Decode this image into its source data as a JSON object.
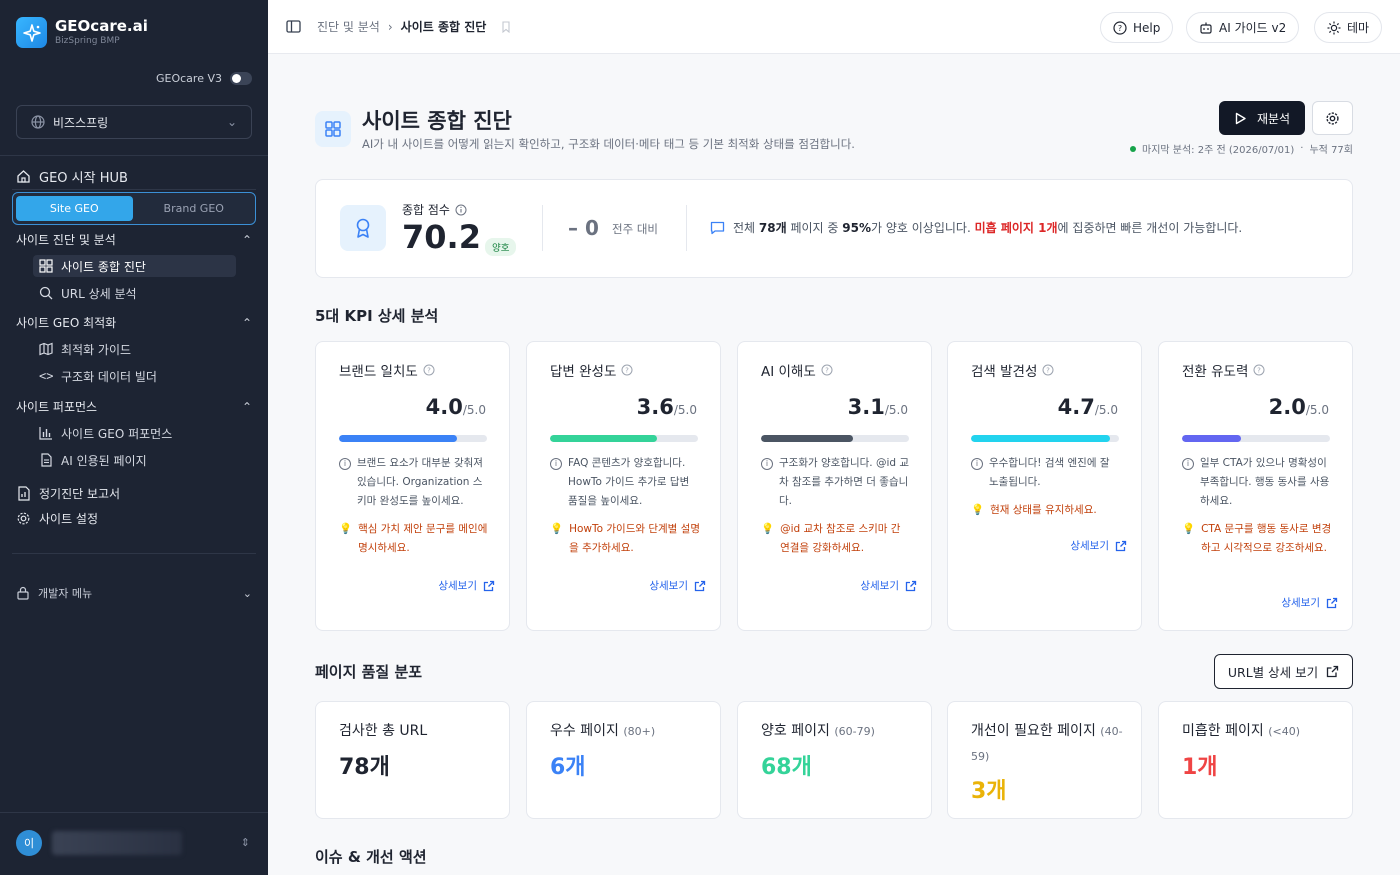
{
  "colors": {
    "sidebar_bg": "#1d2433",
    "accent": "#2563eb",
    "good": "#15803d",
    "warn": "#c2410c",
    "bad": "#dc2626"
  },
  "app": {
    "name": "GEOcare.ai",
    "subtitle": "BizSpring BMP",
    "version_label": "GEOcare V3"
  },
  "sidebar": {
    "org": "비즈스프링",
    "hub": "GEO 시작 HUB",
    "segment": {
      "site": "Site GEO",
      "brand": "Brand GEO"
    },
    "groups": [
      {
        "title": "사이트 진단 및 분석",
        "items": [
          "사이트 종합 진단",
          "URL 상세 분석"
        ]
      },
      {
        "title": "사이트 GEO 최적화",
        "items": [
          "최적화 가이드",
          "구조화 데이터 빌더"
        ]
      },
      {
        "title": "사이트 퍼포먼스",
        "items": [
          "사이트 GEO 퍼포먼스",
          "AI 인용된 페이지"
        ]
      }
    ],
    "report": "정기진단 보고서",
    "settings": "사이트 설정",
    "dev_menu": "개발자 메뉴",
    "user_initial": "이"
  },
  "topbar": {
    "breadcrumb": [
      "진단 및 분석",
      "사이트 종합 진단"
    ],
    "help": "Help",
    "ai_guide": "AI 가이드 v2",
    "theme": "테마"
  },
  "header": {
    "title": "사이트 종합 진단",
    "desc": "AI가 내 사이트를 어떻게 읽는지 확인하고, 구조화 데이터·메타 태그 등 기본 최적화 상태를 점검합니다.",
    "reanalyze": "재분석",
    "last_analysis": "마지막 분석: 2주 전 (2026/07/01)",
    "sep": "·",
    "cumulative": "누적 77회"
  },
  "score": {
    "label": "종합 점수",
    "value": "70.2",
    "badge": "양호",
    "delta": "– 0",
    "delta_label": "전주 대비",
    "summary": {
      "p1": "전체 ",
      "total": "78개",
      "p2": " 페이지 중 ",
      "pct": "95%",
      "p3": "가 양호 이상입니다. ",
      "poor": "미흡 페이지 1개",
      "p4": "에 집중하면 빠른 개선이 가능합니다."
    }
  },
  "kpi_section_title": "5대 KPI 상세 분석",
  "kpis": [
    {
      "name": "브랜드 일치도",
      "score": "4.0",
      "max": "/5.0",
      "ratio": 0.8,
      "color": "#3b82f6",
      "note": "브랜드 요소가 대부분 갖춰져 있습니다. Organization 스키마 완성도를 높이세요.",
      "tip": "핵심 가치 제안 문구를 메인에 명시하세요.",
      "more": "상세보기"
    },
    {
      "name": "답변 완성도",
      "score": "3.6",
      "max": "/5.0",
      "ratio": 0.72,
      "color": "#34d399",
      "note": "FAQ 콘텐츠가 양호합니다. HowTo 가이드 추가로 답변 품질을 높이세요.",
      "tip": "HowTo 가이드와 단계별 설명을 추가하세요.",
      "more": "상세보기"
    },
    {
      "name": "AI 이해도",
      "score": "3.1",
      "max": "/5.0",
      "ratio": 0.62,
      "color": "#4b5563",
      "note": "구조화가 양호합니다. @id 교차 참조를 추가하면 더 좋습니다.",
      "tip": "@id 교차 참조로 스키마 간 연결을 강화하세요.",
      "more": "상세보기"
    },
    {
      "name": "검색 발견성",
      "score": "4.7",
      "max": "/5.0",
      "ratio": 0.94,
      "color": "#22d3ee",
      "note": "우수합니다! 검색 엔진에 잘 노출됩니다.",
      "tip": "현재 상태를 유지하세요.",
      "more": "상세보기"
    },
    {
      "name": "전환 유도력",
      "score": "2.0",
      "max": "/5.0",
      "ratio": 0.4,
      "color": "#6366f1",
      "note": "일부 CTA가 있으나 명확성이 부족합니다. 행동 동사를 사용하세요.",
      "tip": "CTA 문구를 행동 동사로 변경하고 시각적으로 강조하세요.",
      "more": "상세보기"
    }
  ],
  "dist_section_title": "페이지 품질 분포",
  "url_detail_btn": "URL별 상세 보기",
  "dist": [
    {
      "label": "검사한 총 URL",
      "range": "",
      "value": "78개",
      "color": "#1f2430"
    },
    {
      "label": "우수 페이지",
      "range": "(80+)",
      "value": "6개",
      "color": "#3b82f6"
    },
    {
      "label": "양호 페이지",
      "range": "(60-79)",
      "value": "68개",
      "color": "#34d399"
    },
    {
      "label": "개선이 필요한 페이지",
      "range": "(40-59)",
      "value": "3개",
      "color": "#eab308"
    },
    {
      "label": "미흡한 페이지",
      "range": "(<40)",
      "value": "1개",
      "color": "#ef4444"
    }
  ],
  "issues_title": "이슈 & 개선 액션"
}
